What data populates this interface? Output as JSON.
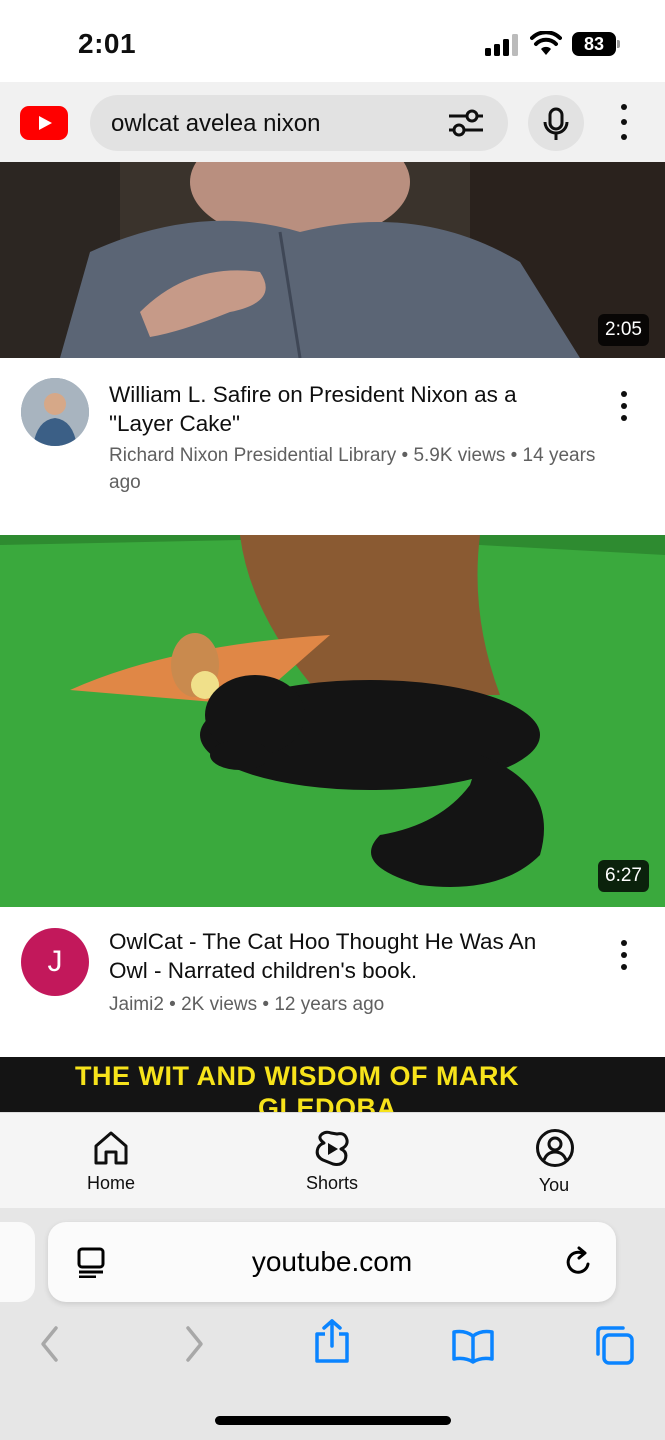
{
  "status_bar": {
    "time": "2:01",
    "battery": "83"
  },
  "header": {
    "search_query": "owlcat avelea nixon"
  },
  "videos": [
    {
      "duration": "2:05",
      "title": "William L. Safire on President Nixon as a \"Layer Cake\"",
      "channel": "Richard Nixon Presidential Library",
      "meta": "Richard Nixon Presidential Library • 5.9K views • 14 years ago"
    },
    {
      "duration": "6:27",
      "title": "OwlCat - The Cat Hoo Thought He Was An Owl - Narrated children's book.",
      "channel": "Jaimi2",
      "avatar_letter": "J",
      "avatar_color": "#c2185b",
      "meta": "Jaimi2 • 2K views • 12 years ago"
    },
    {
      "thumbnail_text": "THE WIT AND WISDOM OF MARK",
      "thumbnail_text_line2": "GLEDOBA"
    }
  ],
  "bottom_nav": [
    {
      "label": "Home",
      "icon": "home-icon"
    },
    {
      "label": "Shorts",
      "icon": "shorts-icon"
    },
    {
      "label": "You",
      "icon": "account-icon"
    }
  ],
  "browser": {
    "url": "youtube.com"
  },
  "colors": {
    "brand_red": "#ff0000",
    "safari_blue": "#0a84ff",
    "meta_gray": "#606060"
  }
}
